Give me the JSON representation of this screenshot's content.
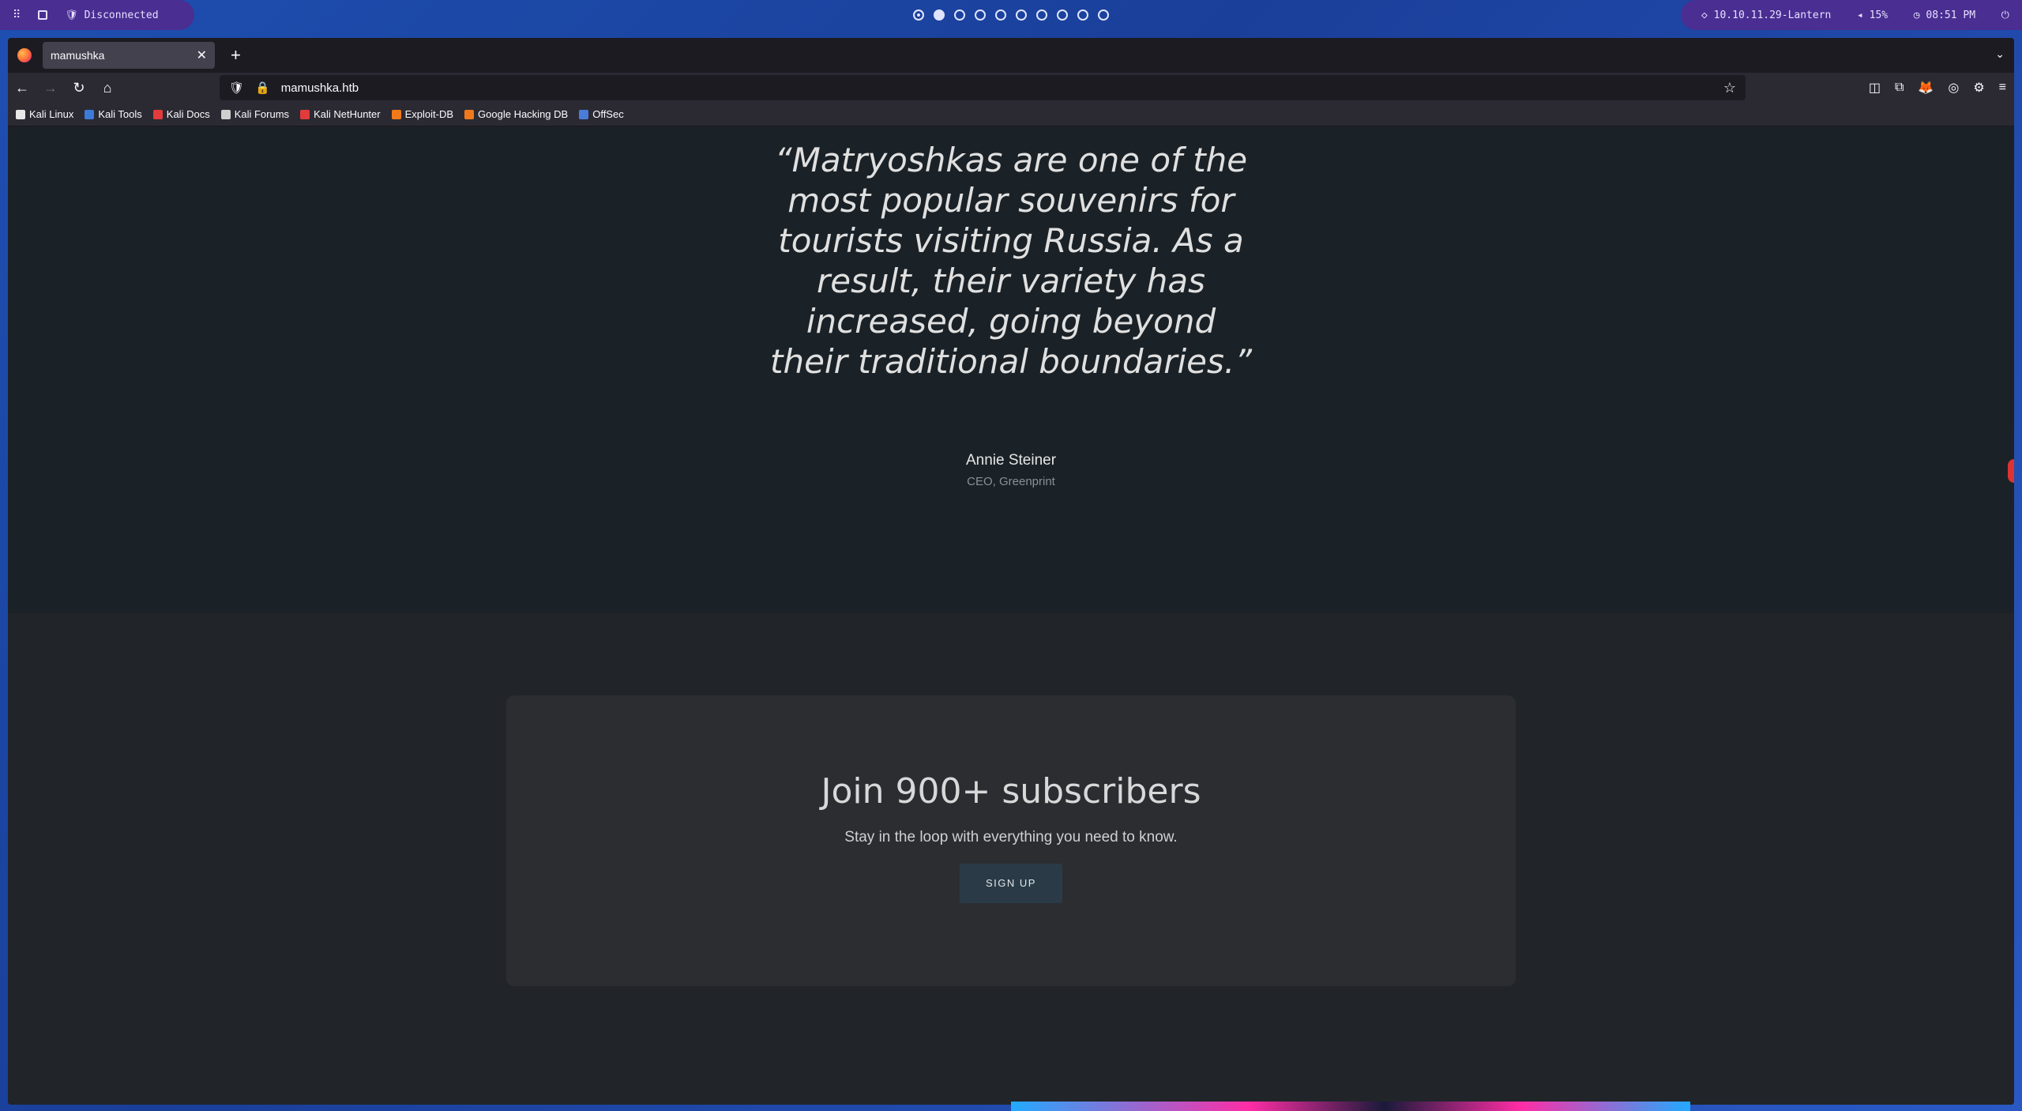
{
  "system_bar": {
    "vpn_status": "Disconnected",
    "network": "10.10.11.29-Lantern",
    "volume": "15%",
    "time": "08:51 PM",
    "workspaces_count": 10
  },
  "browser": {
    "tab_title": "mamushka",
    "url": "mamushka.htb",
    "bookmarks": [
      {
        "label": "Kali Linux",
        "icon": "kali-icon",
        "color": "#e8e8e8"
      },
      {
        "label": "Kali Tools",
        "icon": "kali-tools-icon",
        "color": "#3d7bd9"
      },
      {
        "label": "Kali Docs",
        "icon": "kali-docs-icon",
        "color": "#e33b3b"
      },
      {
        "label": "Kali Forums",
        "icon": "kali-forums-icon",
        "color": "#cfcfcf"
      },
      {
        "label": "Kali NetHunter",
        "icon": "nethunter-icon",
        "color": "#e33b3b"
      },
      {
        "label": "Exploit-DB",
        "icon": "exploitdb-icon",
        "color": "#f07a1b"
      },
      {
        "label": "Google Hacking DB",
        "icon": "ghdb-icon",
        "color": "#f07a1b"
      },
      {
        "label": "OffSec",
        "icon": "offsec-icon",
        "color": "#4a7dd9"
      }
    ]
  },
  "page": {
    "quote": "“Matryoshkas are one of the most popular souvenirs for tourists visiting Russia. As a result, their variety has increased, going beyond their traditional boundaries.”",
    "author": "Annie Steiner",
    "role": "CEO, Greenprint",
    "subscribe": {
      "heading": "Join 900+ subscribers",
      "text": "Stay in the loop with everything you need to know.",
      "button": "SIGN UP"
    }
  }
}
